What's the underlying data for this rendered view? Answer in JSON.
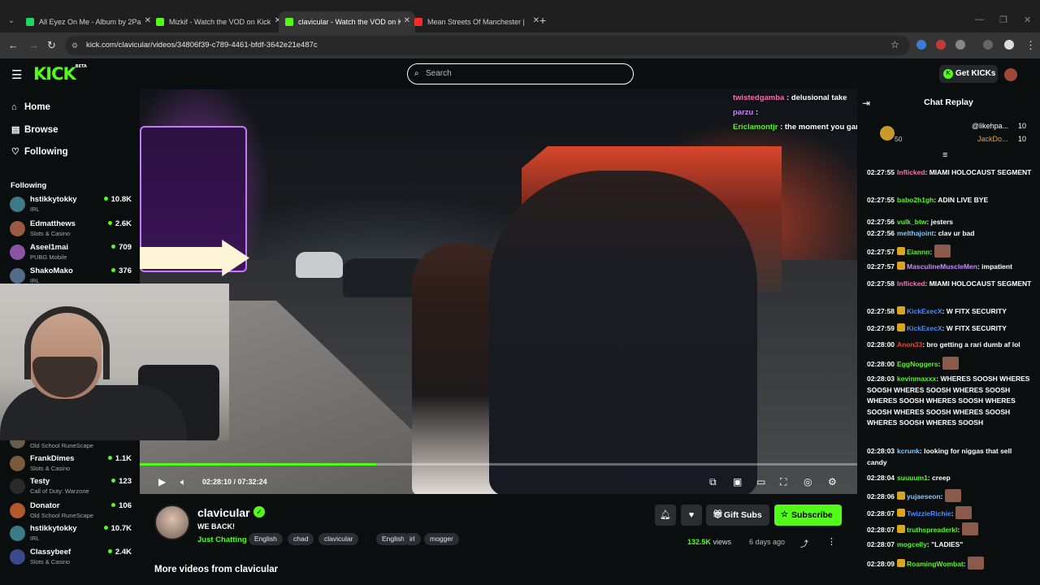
{
  "browser": {
    "tabs": [
      {
        "title": "All Eyez On Me - Album by 2Pa",
        "fav_color": "#1ed760",
        "active": false
      },
      {
        "title": "Mizkif - Watch the VOD on Kick",
        "fav_color": "#53fc18",
        "active": false
      },
      {
        "title": "clavicular - Watch the VOD on K",
        "fav_color": "#53fc18",
        "active": true
      },
      {
        "title": "Mean Streets Of Manchester | ",
        "fav_color": "#ff2a2a",
        "active": false
      }
    ],
    "url": "kick.com/clavicular/videos/34806f39-c789-4461-bfdf-3642e21e487c"
  },
  "header": {
    "logo": "KICK",
    "logo_beta": "BETA",
    "search_placeholder": "Search",
    "get_kicks_label": "Get KICKs"
  },
  "sidebar": {
    "nav": [
      {
        "label": "Home",
        "icon": "home-icon"
      },
      {
        "label": "Browse",
        "icon": "browse-icon"
      },
      {
        "label": "Following",
        "icon": "heart-icon"
      }
    ],
    "following_heading": "Following",
    "following": [
      {
        "name": "hstikkytokky",
        "category": "IRL",
        "viewers": "10.8K",
        "color": "#3b7a86"
      },
      {
        "name": "Edmatthews",
        "category": "Slots & Casino",
        "viewers": "2.6K",
        "color": "#9a5a44"
      },
      {
        "name": "Aseel1mai",
        "category": "PUBG Mobile",
        "viewers": "709",
        "color": "#8a55a5"
      },
      {
        "name": "ShakoMako",
        "category": "IRL",
        "viewers": "376",
        "color": "#556b8a"
      },
      {
        "name": "",
        "category": "Old School RuneScape",
        "viewers": "",
        "color": "#6b5b4a"
      },
      {
        "name": "FrankDimes",
        "category": "Slots & Casino",
        "viewers": "1.1K",
        "color": "#7a5a3a"
      },
      {
        "name": "Testy",
        "category": "Call of Duty: Warzone",
        "viewers": "123",
        "color": "#2a2a2a"
      },
      {
        "name": "Donator",
        "category": "Old School RuneScape",
        "viewers": "106",
        "color": "#b35a2a"
      },
      {
        "name": "hstikkytokky",
        "category": "IRL",
        "viewers": "10.7K",
        "color": "#3b7a86"
      },
      {
        "name": "Classybeef",
        "category": "Slots & Casino",
        "viewers": "2.4K",
        "color": "#3a4a8a"
      }
    ]
  },
  "video_chat_overlay": [
    {
      "user": "twistedgamba",
      "user_color": "#ff6fb5",
      "text": "delusional take"
    },
    {
      "user": "parzu",
      "user_color": "#c98bff",
      "text": ""
    },
    {
      "user": "Ericlamontjr",
      "user_color": "#53fc18",
      "text": "the moment you gamble xqc will come for you @slike"
    }
  ],
  "player": {
    "time_current": "02:28:10",
    "time_total": "07:32:24",
    "progress": 0.33
  },
  "channel": {
    "name": "clavicular",
    "title": "WE BACK!",
    "category": "Just Chatting",
    "tags": [
      "English",
      "chad",
      "clavicular",
      "English",
      "irl",
      "mogger"
    ],
    "gift_label": "Gift Subs",
    "subscribe_label": "Subscribe",
    "views": "132.5K",
    "views_suffix": "views",
    "ago": "6 days ago",
    "more_videos": "More videos from clavicular"
  },
  "chat": {
    "title": "Chat Replay",
    "pinned": {
      "amount": "50",
      "row1_user": "@likehpa...",
      "row1_value": "10",
      "row2_user": "JackDo...",
      "row2_value": "10"
    },
    "messages": [
      {
        "ts": "02:27:55",
        "user": "Inflicked",
        "color": "#ff6fb5",
        "text": "MIAMI HOLOCAUST SEGMENT"
      },
      {
        "ts": "02:27:55",
        "user": "babo2h1gh",
        "color": "#53fc18",
        "text": "ADIN LIVE BYE"
      },
      {
        "ts": "02:27:56",
        "user": "vulk_btw",
        "color": "#53fc18",
        "text": "jesters"
      },
      {
        "ts": "02:27:56",
        "user": "melthajoint",
        "color": "#7fc8ff",
        "text": "clav ur bad"
      },
      {
        "ts": "02:27:57",
        "user": "Eiannn",
        "color": "#53fc18",
        "text": ""
      },
      {
        "ts": "02:27:57",
        "user": "MasculineMuscleMen",
        "color": "#c98bff",
        "text": "impatient"
      },
      {
        "ts": "02:27:58",
        "user": "Inflicked",
        "color": "#ff6fb5",
        "text": "MIAMI HOLOCAUST SEGMENT"
      },
      {
        "ts": "02:27:58",
        "user": "KickExecX",
        "color": "#4a8cff",
        "text": "W FITX SECURITY"
      },
      {
        "ts": "02:27:59",
        "user": "KickExecX",
        "color": "#4a8cff",
        "text": "W FITX SECURITY"
      },
      {
        "ts": "02:28:00",
        "user": "Anon33",
        "color": "#ff3b3b",
        "text": "bro getting a rari dumb af lol"
      },
      {
        "ts": "02:28:00",
        "user": "EggNoggers",
        "color": "#53fc18",
        "text": ""
      },
      {
        "ts": "02:28:03",
        "user": "kevinmaxxx",
        "color": "#53fc18",
        "text": "WHERES SOOSH WHERES SOOSH WHERES SOOSH WHERES SOOSH WHERES SOOSH WHERES SOOSH WHERES SOOSH WHERES SOOSH WHERES SOOSH WHERES SOOSH WHERES SOOSH"
      },
      {
        "ts": "02:28:03",
        "user": "kcrunk",
        "color": "#7fc8ff",
        "text": "looking for niggas that sell candy"
      },
      {
        "ts": "02:28:04",
        "user": "suuuum1",
        "color": "#53fc18",
        "text": "creep"
      },
      {
        "ts": "02:28:06",
        "user": "yujaeseon",
        "color": "#7fc8ff",
        "text": ""
      },
      {
        "ts": "02:28:07",
        "user": "TwizzieRichie",
        "color": "#4a8cff",
        "text": ""
      },
      {
        "ts": "02:28:07",
        "user": "truthspreaderkl",
        "color": "#53fc18",
        "text": ""
      },
      {
        "ts": "02:28:07",
        "user": "mogcelly",
        "color": "#53fc18",
        "text": "\"LADIES\""
      },
      {
        "ts": "02:28:09",
        "user": "RoamingWombat",
        "color": "#53fc18",
        "text": ""
      }
    ]
  },
  "colors": {
    "accent": "#53fc18",
    "background": "#0b0e0f",
    "surface": "#2a2d31"
  }
}
